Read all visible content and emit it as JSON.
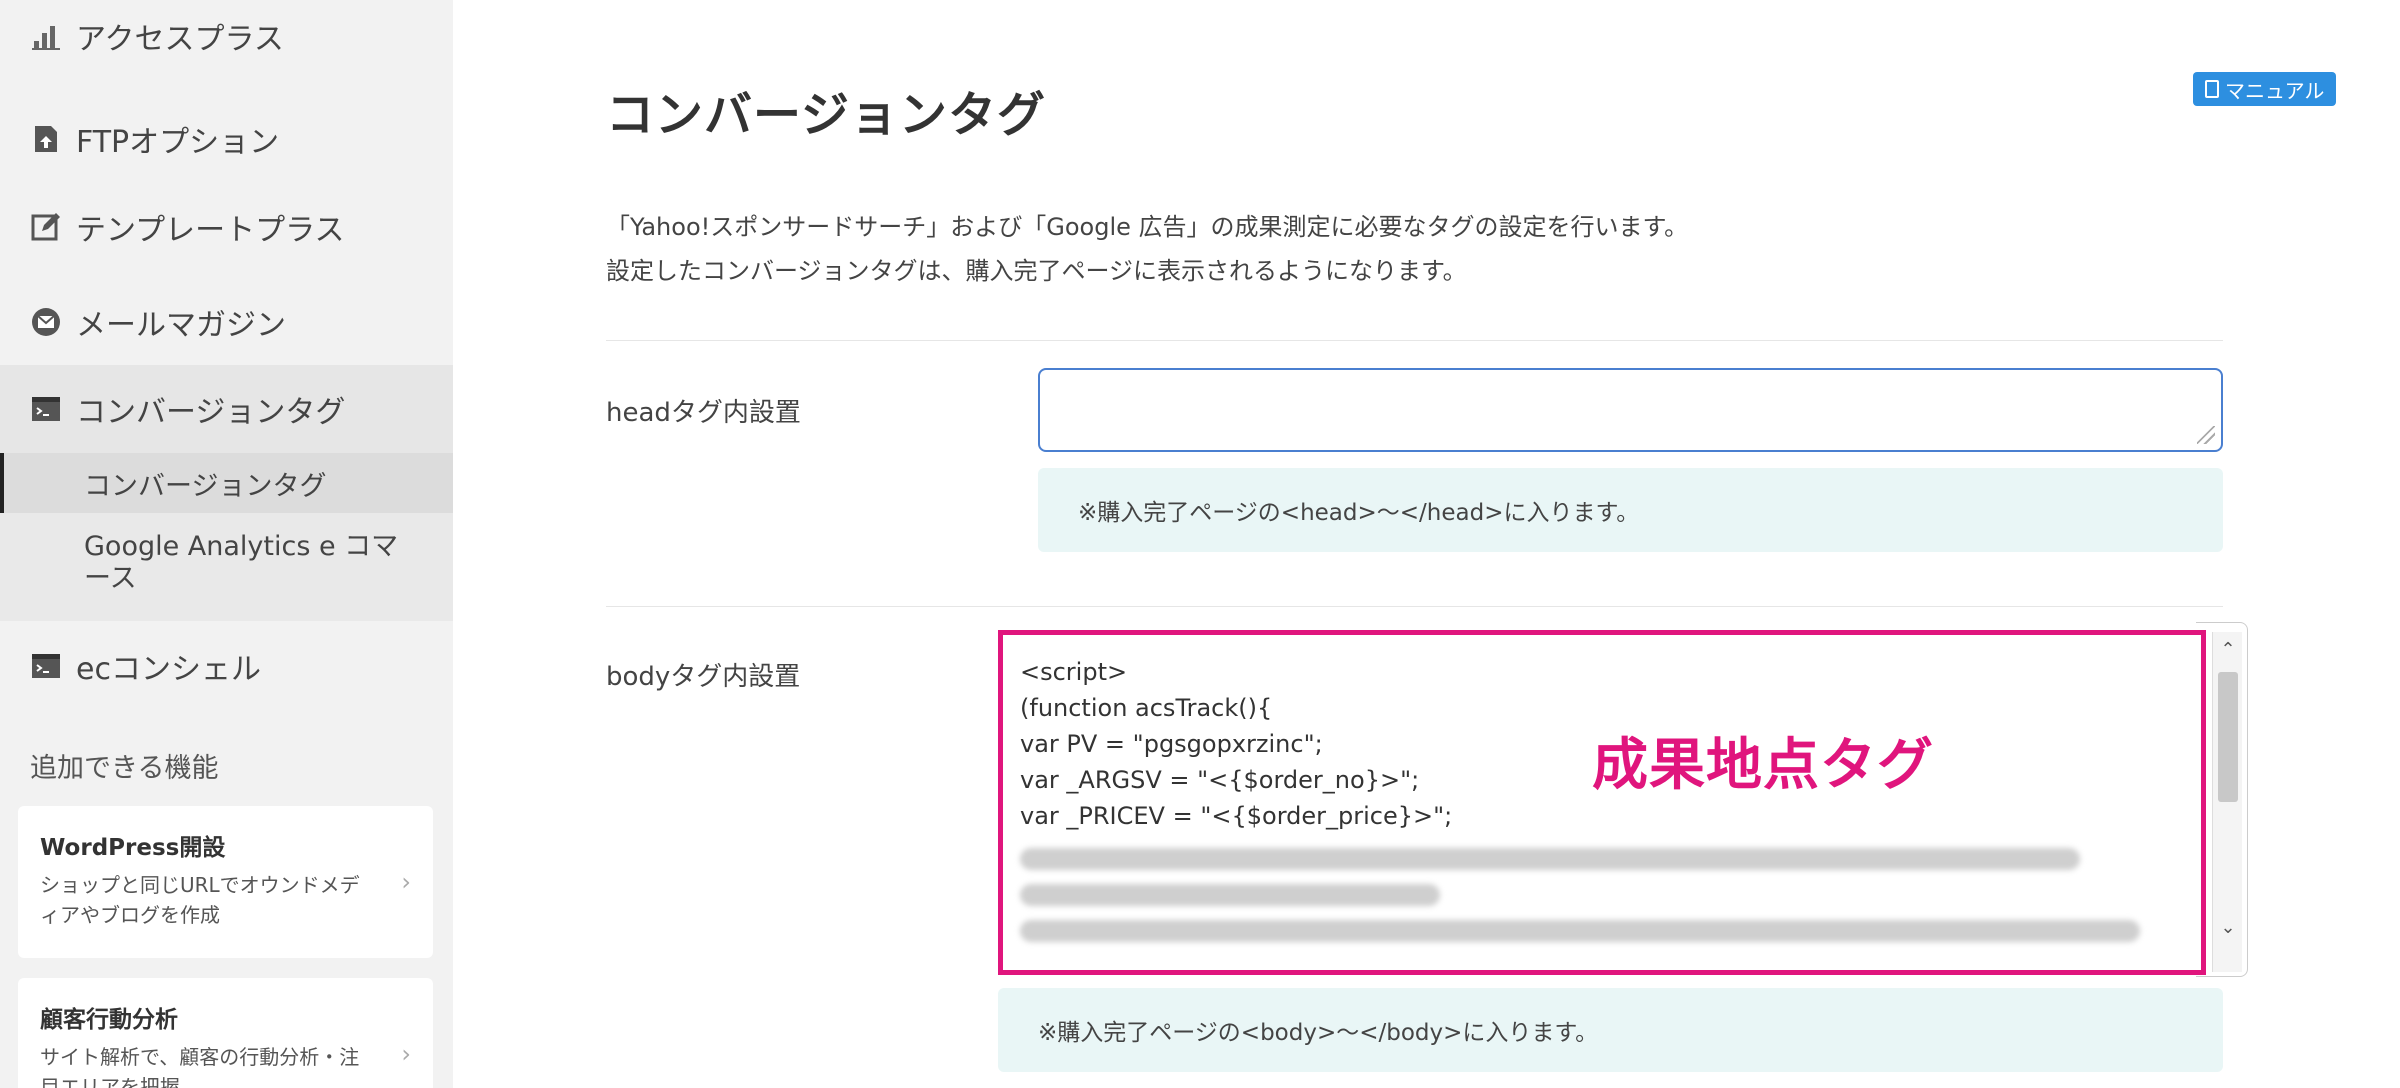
{
  "sidebar": {
    "items": [
      {
        "label": "アクセスプラス",
        "icon": "chart-icon"
      },
      {
        "label": "FTPオプション",
        "icon": "ftp-upload-icon"
      },
      {
        "label": "テンプレートプラス",
        "icon": "edit-icon"
      },
      {
        "label": "メールマガジン",
        "icon": "mail-icon"
      },
      {
        "label": "コンバージョンタグ",
        "icon": "terminal-icon"
      },
      {
        "label": "ecコンシェル",
        "icon": "terminal-icon"
      }
    ],
    "sub_items": [
      {
        "label": "コンバージョンタグ"
      },
      {
        "label": "Google Analytics e コマース"
      }
    ],
    "section_label": "追加できる機能",
    "cards": [
      {
        "title": "WordPress開設",
        "desc": "ショップと同じURLでオウンドメディアやブログを作成"
      },
      {
        "title": "顧客行動分析",
        "desc": "サイト解析で、顧客の行動分析・注目エリアを把握"
      }
    ]
  },
  "main": {
    "title": "コンバージョンタグ",
    "manual_label": "マニュアル",
    "description": [
      "「Yahoo!スポンサードサーチ」および「Google 広告」の成果測定に必要なタグの設定を行います。",
      "設定したコンバージョンタグは、購入完了ページに表示されるようになります。"
    ],
    "head_field": {
      "label": "headタグ内設置",
      "value": "",
      "hint": "※購入完了ページの<head>～</head>に入ります。"
    },
    "body_field": {
      "label": "bodyタグ内設置",
      "lines": [
        "<script>",
        "(function acsTrack(){",
        "var PV = \"pgsgopxrzinc\";",
        "var _ARGSV = \"<{$order_no}>\";",
        "var _PRICEV = \"<{$order_price}>\";"
      ],
      "hint": "※購入完了ページの<body>～</body>に入ります。"
    },
    "annotation": "成果地点タグ"
  },
  "colors": {
    "accent": "#2d8fe0",
    "highlight": "#e0157d",
    "hint_bg": "#e9f6f6",
    "sidebar_bg": "#f2f2f2"
  }
}
